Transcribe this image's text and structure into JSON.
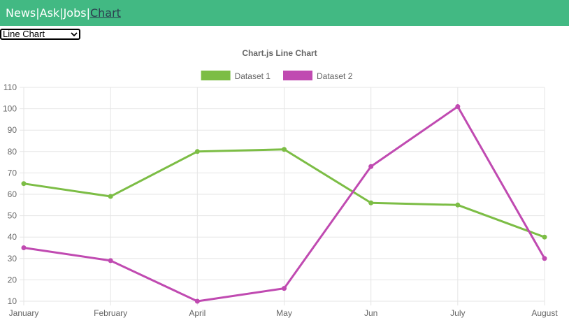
{
  "nav": {
    "links": [
      "News",
      "Ask",
      "Jobs",
      "Chart"
    ],
    "separator": "|",
    "active": "Chart"
  },
  "chart_select": {
    "selected": "Line Chart"
  },
  "colors": {
    "navbar": "#42b983",
    "active_link": "#2c3e50",
    "dataset1": "#7cbd45",
    "dataset2": "#c04ab1",
    "grid": "#e5e5e5",
    "text": "#666666"
  },
  "chart_data": {
    "type": "line",
    "title": "Chart.js Line Chart",
    "categories": [
      "January",
      "February",
      "April",
      "May",
      "Jun",
      "July",
      "August"
    ],
    "series": [
      {
        "name": "Dataset 1",
        "values": [
          65,
          59,
          80,
          81,
          56,
          55,
          40
        ]
      },
      {
        "name": "Dataset 2",
        "values": [
          35,
          29,
          10,
          16,
          73,
          101,
          30
        ]
      }
    ],
    "ylim": [
      10,
      110
    ],
    "y_ticks": [
      10,
      20,
      30,
      40,
      50,
      60,
      70,
      80,
      90,
      100,
      110
    ],
    "grid": true,
    "legend": "top"
  }
}
